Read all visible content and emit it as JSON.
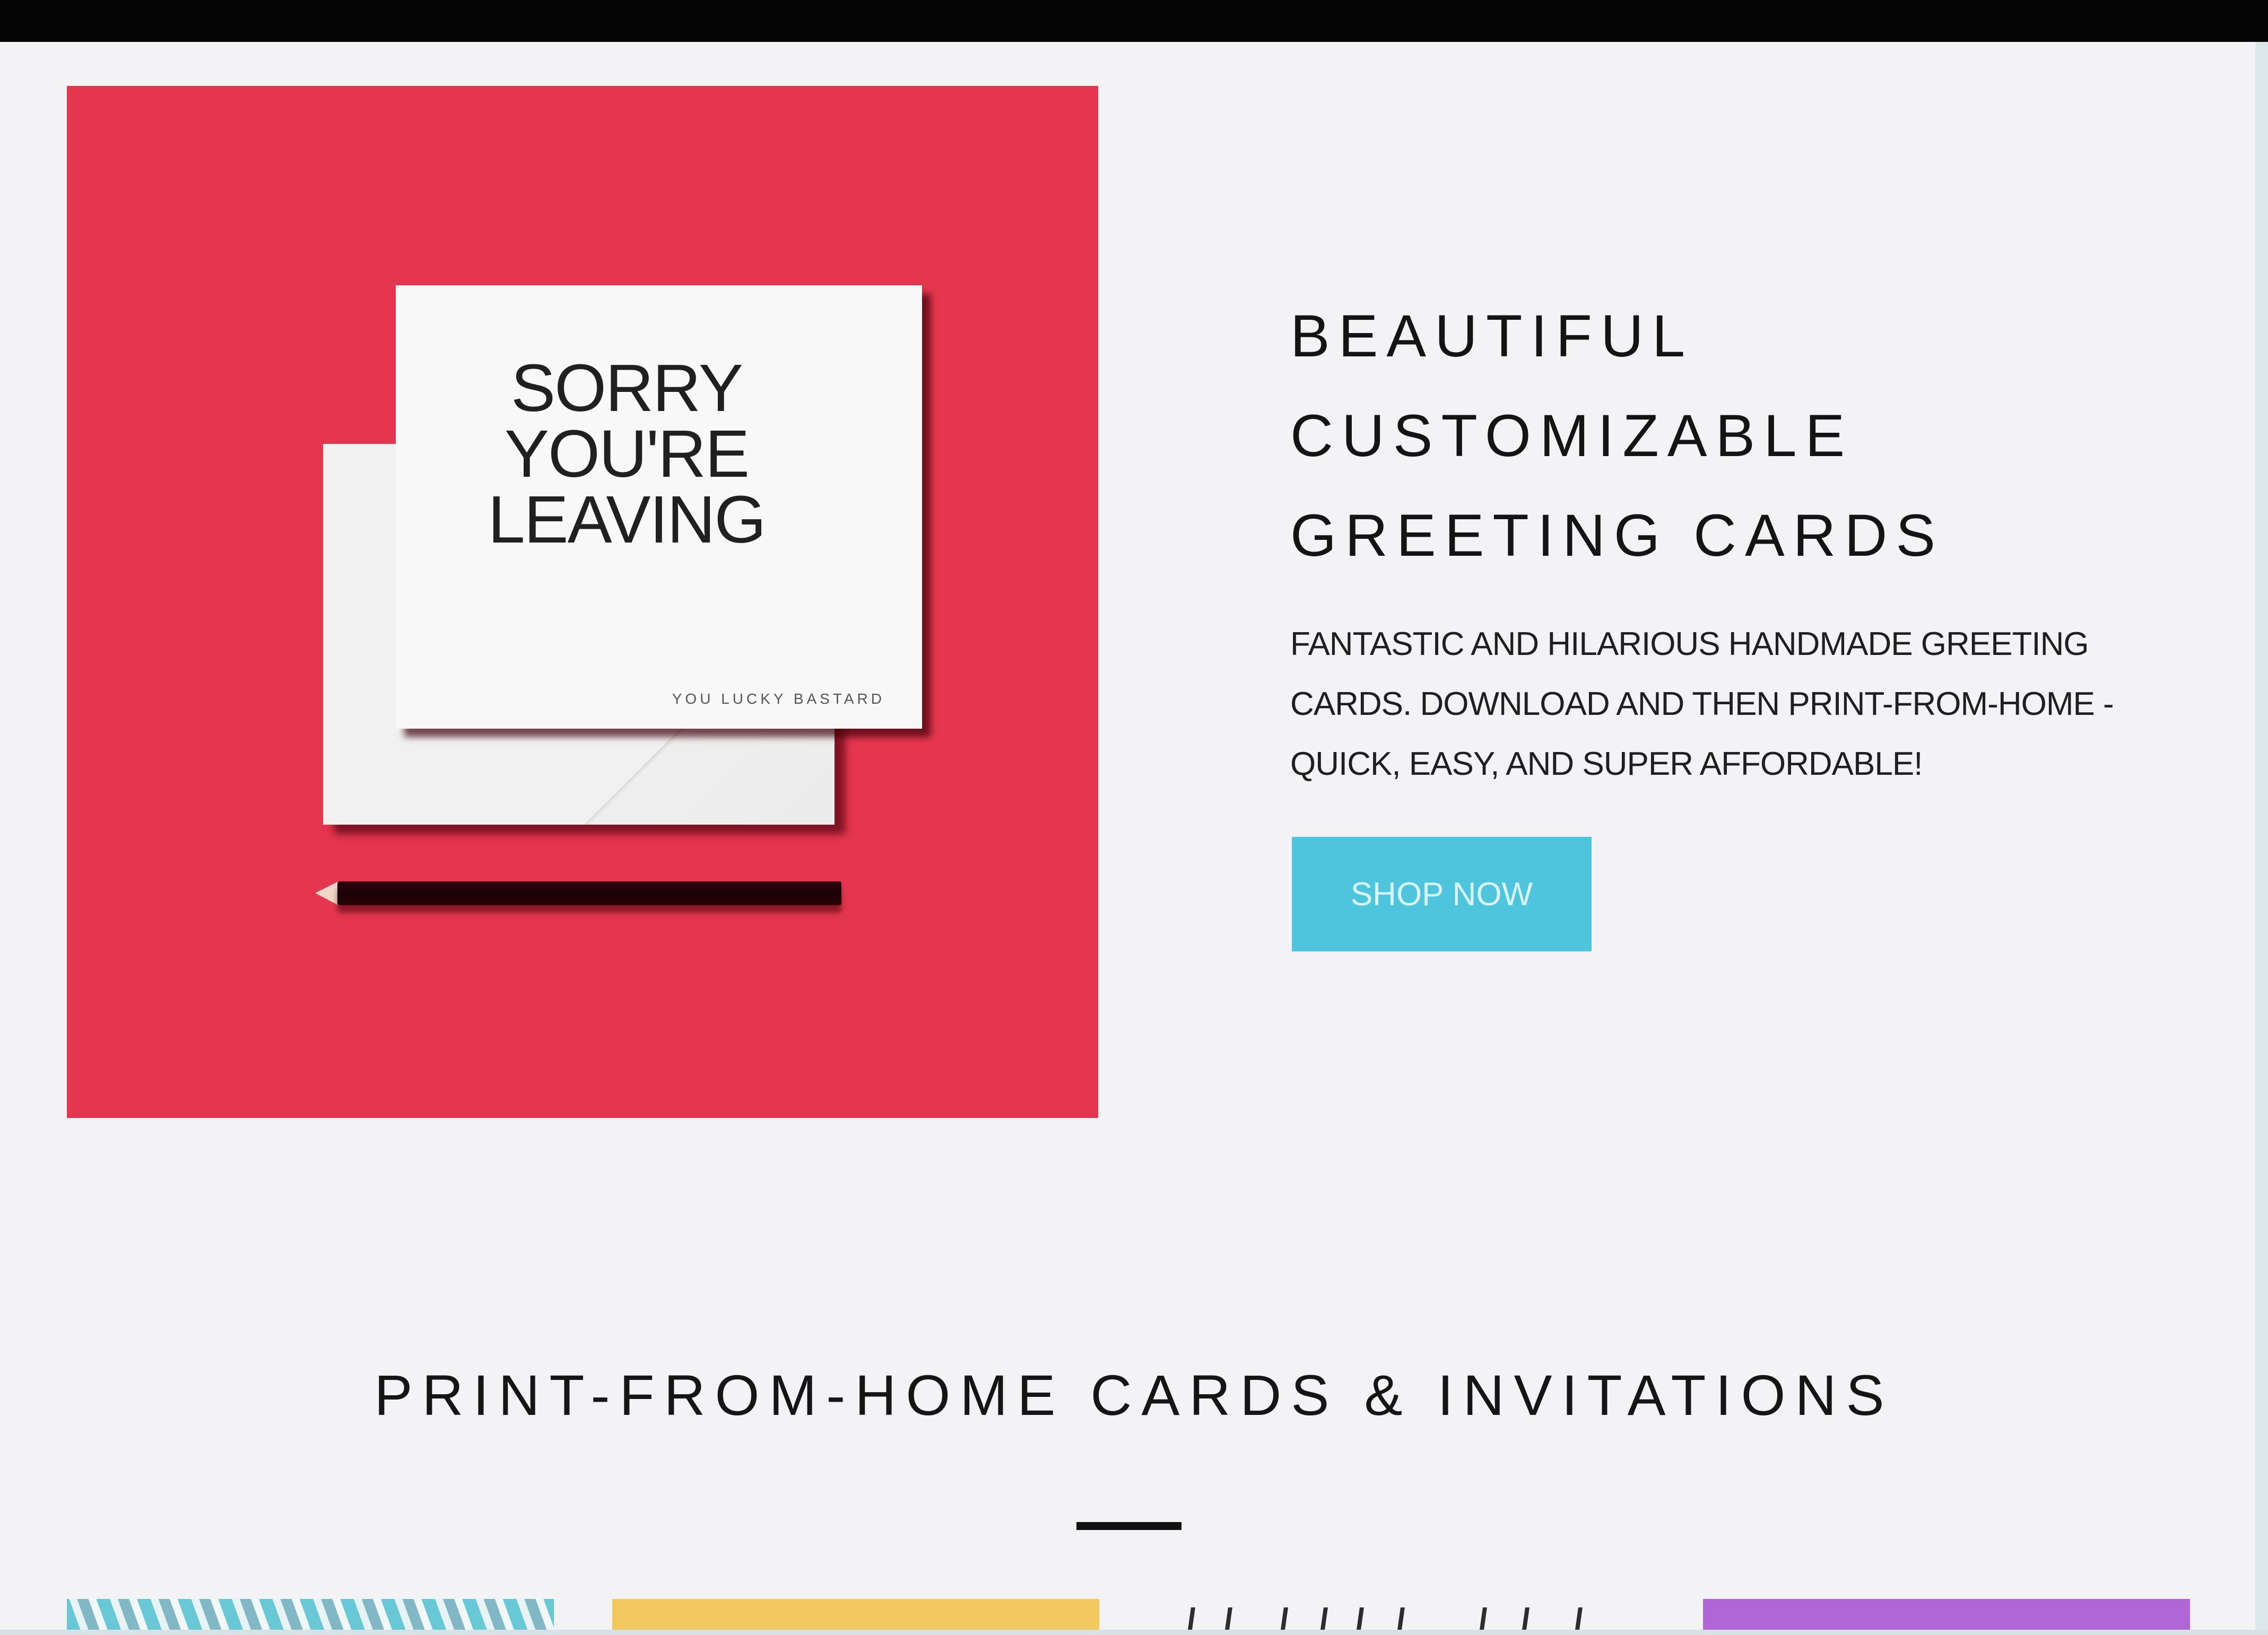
{
  "hero": {
    "image": {
      "card_title": "SORRY\nYOU'RE\nLEAVING",
      "card_subtitle": "YOU LUCKY BASTARD",
      "background_color": "#e5364f"
    },
    "heading_lines": [
      "BEAUTIFUL",
      "CUSTOMIZABLE",
      "GREETING CARDS"
    ],
    "description_lines": [
      "FANTASTIC AND HILARIOUS HANDMADE GREETING",
      "CARDS. DOWNLOAD AND THEN PRINT-FROM-HOME -",
      "QUICK, EASY, AND SUPER AFFORDABLE!"
    ],
    "button": {
      "label": "SHOP NOW",
      "color": "#4ec5dc"
    }
  },
  "section": {
    "title": "PRINT-FROM-HOME CARDS & INVITATIONS"
  },
  "colors": {
    "page_background": "#f3f3f5",
    "top_bar": "#050505",
    "text": "#151515",
    "divider": "#111111"
  },
  "product_previews": [
    {
      "color": "#69c8d6"
    },
    {
      "color": "#f1c95f"
    },
    {
      "color": "#f3f3f5"
    },
    {
      "color": "#b166d8"
    }
  ]
}
